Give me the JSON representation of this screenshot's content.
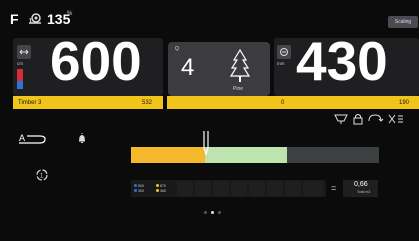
{
  "status": {
    "f_label": "F",
    "number": "135",
    "unit": "%",
    "snail_icon": "snail-icon",
    "top_button": "Scaling"
  },
  "left_panel": {
    "unit": "cm",
    "value": "600",
    "strip_label": "Timber 3",
    "strip_value": "532"
  },
  "middle_panel": {
    "q_label": "Q",
    "count": "4",
    "wood_type": "Pine",
    "tree_icon": "tree-icon"
  },
  "right_panel": {
    "unit": "mm",
    "value": "430",
    "strip_left": "0",
    "strip_right": "190"
  },
  "toolbar_icons": [
    "grapple-icon",
    "lock-icon",
    "rotate-icon",
    "settings-icon"
  ],
  "side_icons": [
    "feed-icon",
    "bell-icon",
    "cycle-icon"
  ],
  "progress": {
    "yellow_fraction": 0.3,
    "green_fraction": 0.33
  },
  "legend": [
    {
      "items": [
        {
          "label": "500",
          "color": "#2d73d6"
        },
        {
          "label": "300",
          "color": "#2d73d6"
        }
      ]
    },
    {
      "items": [
        {
          "label": "870",
          "color": "#f0c419"
        },
        {
          "label": "365",
          "color": "#f0c419"
        }
      ]
    }
  ],
  "result": {
    "equals": "=",
    "value": "0,66",
    "label": "Total m3"
  },
  "pagination": {
    "count": 3,
    "active": 1
  },
  "colors": {
    "accent_yellow": "#f0c419",
    "progress_yellow": "#f4b92a",
    "progress_green": "#bde3b0",
    "red": "#d92c3a",
    "blue": "#2d73d6"
  }
}
